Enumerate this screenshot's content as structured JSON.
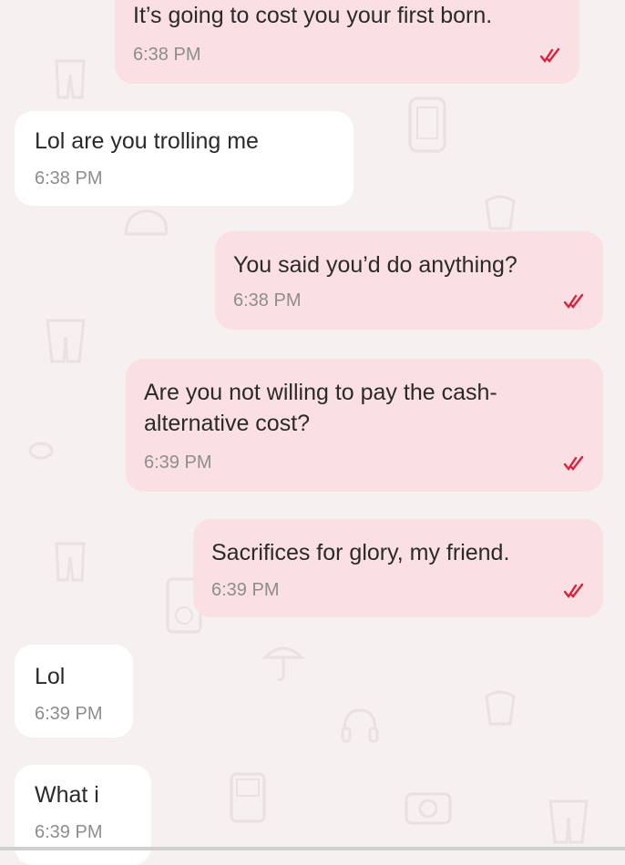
{
  "theme": {
    "background": "#f6f0f0",
    "incoming_bubble": "#ffffff",
    "outgoing_bubble": "#fbe0e3",
    "text_color": "#2a2a2a",
    "time_color": "#8d8d8d",
    "read_receipt_color": "#d9233f"
  },
  "messages": [
    {
      "direction": "outgoing",
      "text": "It’s going to cost you your first born.",
      "time": "6:38 PM",
      "status_icon": "double-check-icon"
    },
    {
      "direction": "incoming",
      "text": "Lol are you trolling me",
      "time": "6:38 PM"
    },
    {
      "direction": "outgoing",
      "text": "You said you’d do anything?",
      "time": "6:38 PM",
      "status_icon": "double-check-icon"
    },
    {
      "direction": "outgoing",
      "text_line1": "Are you not willing to pay the cash-",
      "text_line2": "alternative cost?",
      "time": "6:39 PM",
      "status_icon": "double-check-icon"
    },
    {
      "direction": "outgoing",
      "text": "Sacrifices for glory, my friend.",
      "time": "6:39 PM",
      "status_icon": "double-check-icon"
    },
    {
      "direction": "incoming",
      "text": "Lol",
      "time": "6:39 PM"
    },
    {
      "direction": "incoming",
      "text": "What i",
      "time": "6:39 PM"
    }
  ],
  "background_doodles": [
    "jeans-icon",
    "phone-icon",
    "bag-icon",
    "cap-icon",
    "headphones-icon",
    "candy-icon",
    "camera-icon",
    "gameboy-icon",
    "ipod-icon",
    "umbrella-icon"
  ]
}
